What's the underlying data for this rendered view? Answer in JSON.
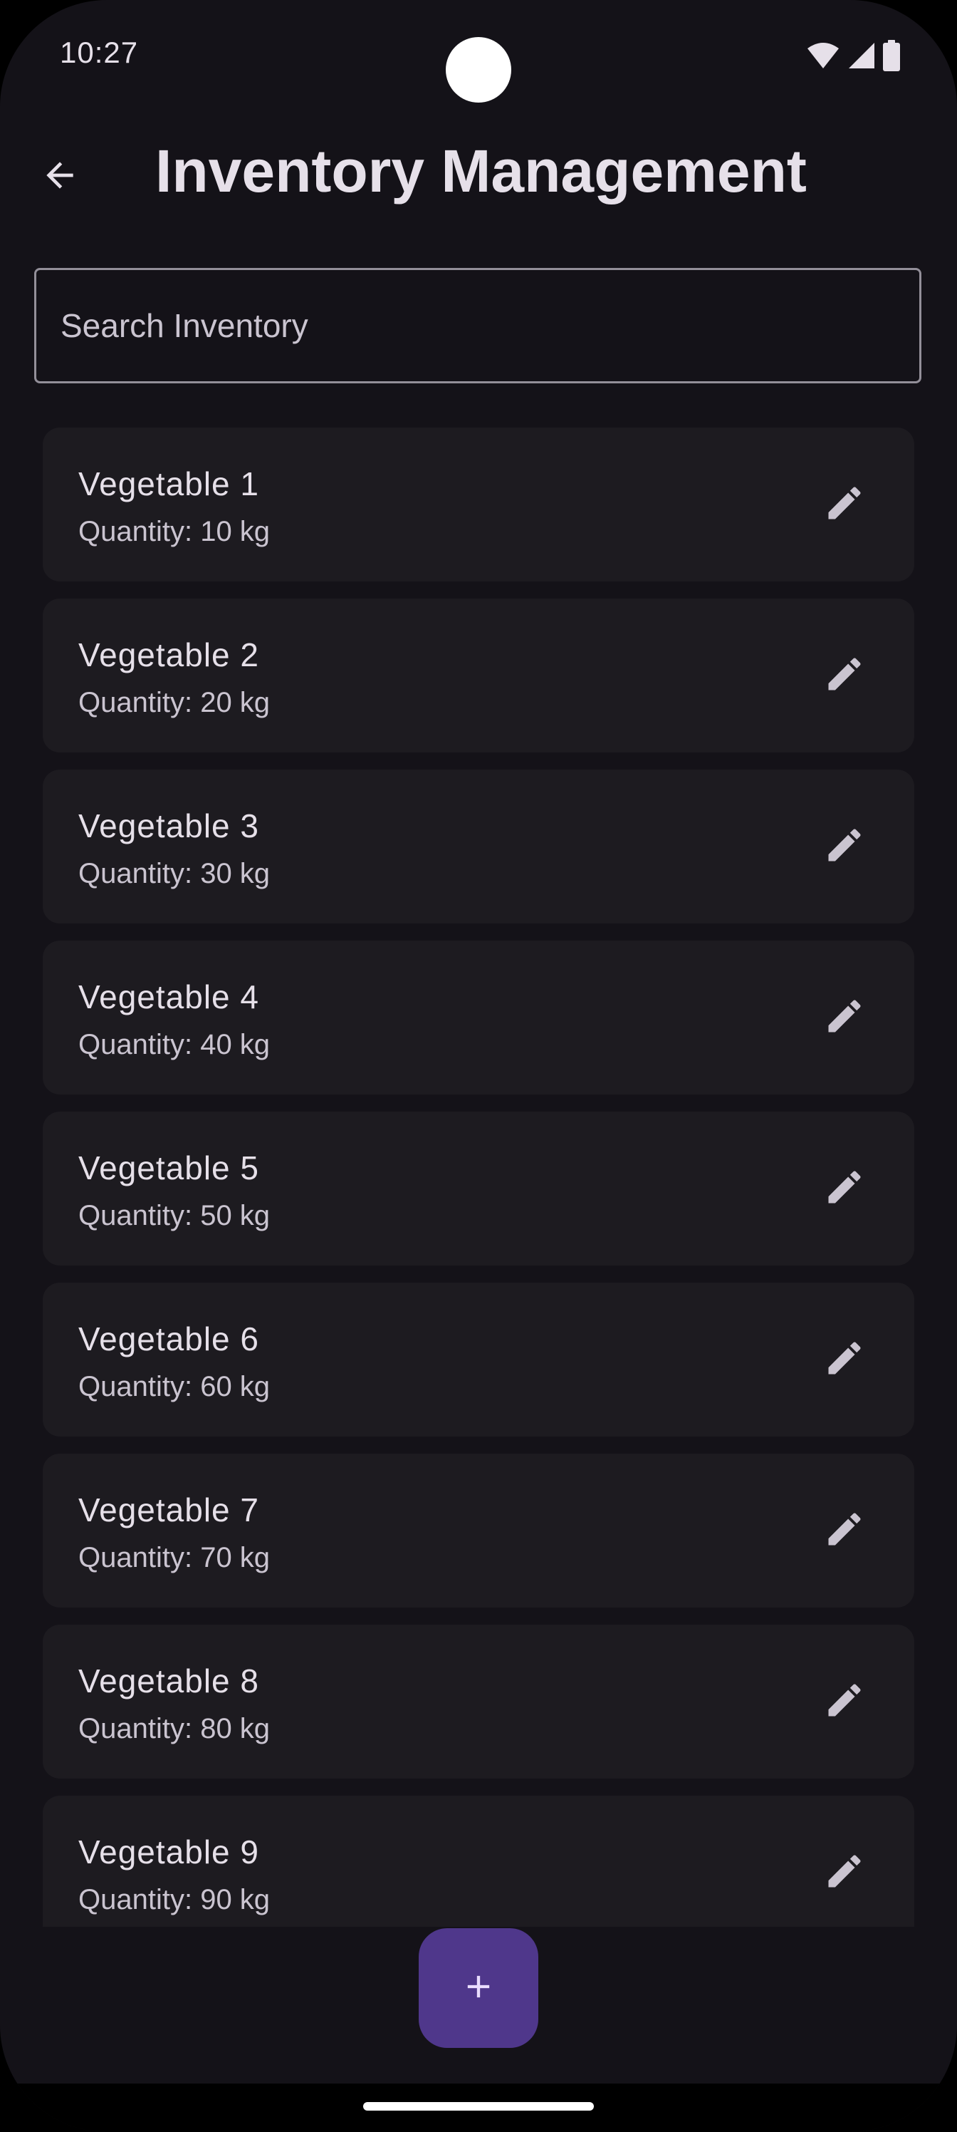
{
  "status_bar": {
    "time": "10:27",
    "icons": [
      "wifi-icon",
      "signal-icon",
      "battery-icon"
    ]
  },
  "app_bar": {
    "title": "Inventory Management",
    "back_icon": "arrow-back-icon"
  },
  "search": {
    "placeholder": "Search Inventory",
    "value": ""
  },
  "inventory": {
    "items": [
      {
        "name": "Vegetable 1",
        "quantity": "Quantity: 10 kg"
      },
      {
        "name": "Vegetable 2",
        "quantity": "Quantity: 20 kg"
      },
      {
        "name": "Vegetable 3",
        "quantity": "Quantity: 30 kg"
      },
      {
        "name": "Vegetable 4",
        "quantity": "Quantity: 40 kg"
      },
      {
        "name": "Vegetable 5",
        "quantity": "Quantity: 50 kg"
      },
      {
        "name": "Vegetable 6",
        "quantity": "Quantity: 60 kg"
      },
      {
        "name": "Vegetable 7",
        "quantity": "Quantity: 70 kg"
      },
      {
        "name": "Vegetable 8",
        "quantity": "Quantity: 80 kg"
      },
      {
        "name": "Vegetable 9",
        "quantity": "Quantity: 90 kg"
      }
    ],
    "edit_icon": "pencil-edit-icon"
  },
  "fab": {
    "icon": "plus-icon"
  },
  "colors": {
    "background": "#141218",
    "card": "#1D1B20",
    "text_primary": "#E6E0E9",
    "text_secondary": "#CAC4D0",
    "fab": "#4F378B",
    "outline": "#938F99"
  }
}
